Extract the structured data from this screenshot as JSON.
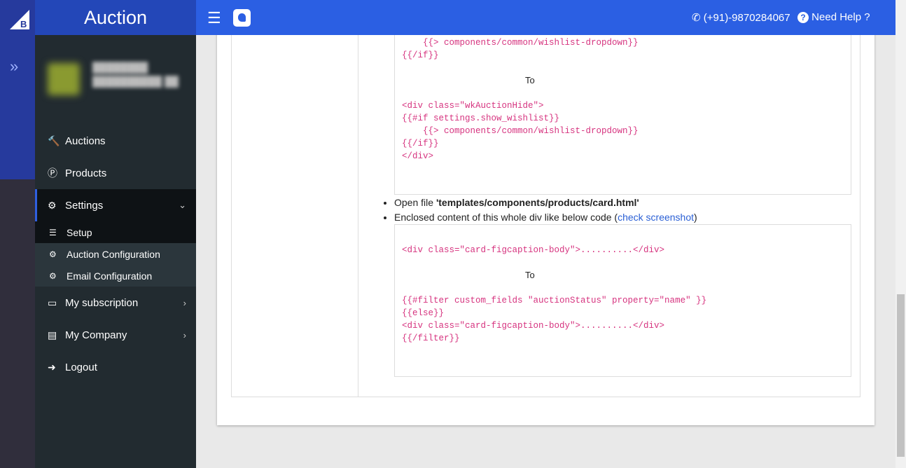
{
  "app": {
    "title": "Auction"
  },
  "sidebar": {
    "items": [
      {
        "label": "Auctions",
        "icon": "gavel-icon"
      },
      {
        "label": "Products",
        "icon": "product-icon"
      },
      {
        "label": "Settings",
        "icon": "gear-icon"
      },
      {
        "label": "My subscription",
        "icon": "credit-card-icon"
      },
      {
        "label": "My Company",
        "icon": "id-card-icon"
      },
      {
        "label": "Logout",
        "icon": "logout-icon"
      }
    ],
    "subitems": [
      {
        "label": "Setup"
      },
      {
        "label": "Auction Configuration"
      },
      {
        "label": "Email Configuration"
      }
    ]
  },
  "topbar": {
    "phone": "(+91)-9870284067",
    "help": "Need Help ?"
  },
  "content": {
    "code1": [
      "    {{> components/common/wishlist-dropdown}}",
      "{{/if}}",
      "",
      "To",
      "",
      "<div class=\"wkAuctionHide\">",
      "{{#if settings.show_wishlist}}",
      "    {{> components/common/wishlist-dropdown}}",
      "{{/if}}",
      "</div>"
    ],
    "bullet1_prefix": "Open file ",
    "bullet1_file": "'templates/components/products/card.html'",
    "bullet2_prefix": "Enclosed content of this whole div like below code (",
    "bullet2_link": "check screenshot",
    "bullet2_suffix": ")",
    "code2": [
      "<div class=\"card-figcaption-body\">..........</div>",
      "",
      "To",
      "",
      "{{#filter custom_fields \"auctionStatus\" property=\"name\" }}",
      "{{else}}",
      "<div class=\"card-figcaption-body\">..........</div>",
      "{{/filter}}"
    ]
  }
}
